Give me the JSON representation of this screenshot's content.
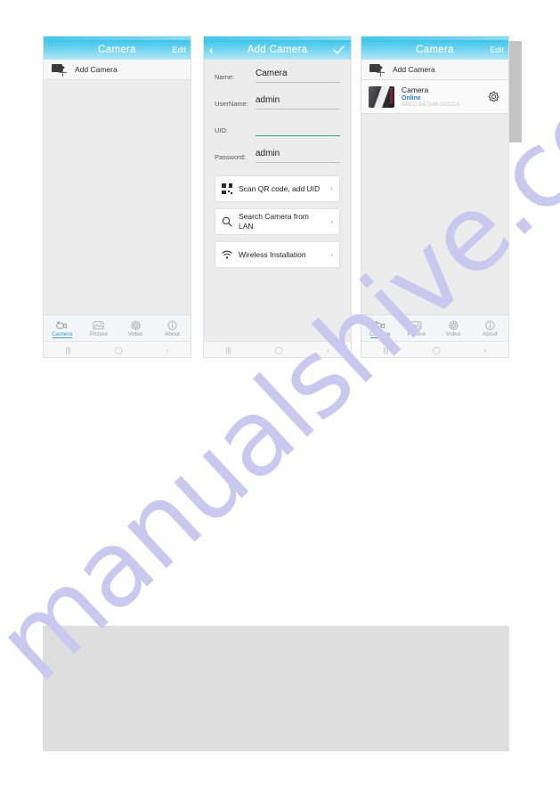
{
  "watermark": {
    "text": "manualshive.com"
  },
  "phone1": {
    "navbar": {
      "title": "Camera",
      "edit_label": "Edit"
    },
    "add_camera": {
      "label": "Add Camera",
      "icon": "camera-plus-icon"
    },
    "tabs": [
      {
        "label": "Camera",
        "icon": "camera-icon",
        "active": true
      },
      {
        "label": "Picture",
        "icon": "picture-icon",
        "active": false
      },
      {
        "label": "Video",
        "icon": "video-icon",
        "active": false
      },
      {
        "label": "About",
        "icon": "info-icon",
        "active": false
      }
    ],
    "system_nav": {
      "recents": "|||",
      "home": "◯",
      "back": "‹"
    }
  },
  "phone2": {
    "navbar": {
      "title": "Add Camera",
      "back_icon": "chevron-left-icon",
      "confirm_icon": "check-icon"
    },
    "fields": [
      {
        "label": "Name:",
        "value": "Camera",
        "focused": false
      },
      {
        "label": "UserName:",
        "value": "admin",
        "focused": false
      },
      {
        "label": "UID:",
        "value": "",
        "focused": true
      },
      {
        "label": "Password:",
        "value": "admin",
        "focused": false
      }
    ],
    "actions": [
      {
        "label": "Scan QR code, add UID",
        "icon": "qr-code-icon",
        "chevron": "›"
      },
      {
        "label": "Search Camera from LAN",
        "icon": "search-icon",
        "chevron": "›"
      },
      {
        "label": "Wireless Installation",
        "icon": "wifi-icon",
        "chevron": "›"
      }
    ]
  },
  "phone3": {
    "navbar": {
      "title": "Camera",
      "edit_label": "Edit"
    },
    "add_camera": {
      "label": "Add Camera",
      "icon": "camera-plus-icon"
    },
    "camera": {
      "name": "Camera",
      "status": "Online",
      "uid": "AACC-947149-DCCCA",
      "gear_icon": "gear-icon",
      "thumbnail": "camera-thumbnail"
    },
    "tabs": [
      {
        "label": "Camera",
        "icon": "camera-icon",
        "active": true
      },
      {
        "label": "Picture",
        "icon": "picture-icon",
        "active": false
      },
      {
        "label": "Video",
        "icon": "video-icon",
        "active": false
      },
      {
        "label": "About",
        "icon": "info-icon",
        "active": false
      }
    ],
    "system_nav": {
      "recents": "|||",
      "home": "◯",
      "back": "‹"
    }
  },
  "colors": {
    "nav_gradient_start": "#3fc4ea",
    "nav_gradient_end": "#b4e7f7",
    "accent_blue": "#3d9bd4",
    "status_blue": "#2f79c9",
    "focus_green": "#2fa884",
    "watermark": "#c9c9ef"
  }
}
